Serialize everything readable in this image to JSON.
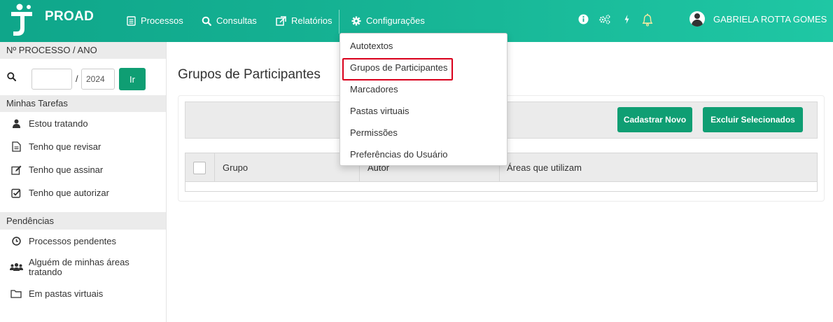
{
  "app": {
    "name": "PROAD"
  },
  "nav": {
    "processos": "Processos",
    "consultas": "Consultas",
    "relatorios": "Relatórios",
    "configuracoes": "Configurações"
  },
  "user": {
    "name": "GABRIELA ROTTA GOMES"
  },
  "icons": {
    "info": "info-icon",
    "cogs": "cogs-icon",
    "bolt": "bolt-icon",
    "bell": "bell-icon",
    "search": "search-icon",
    "user": "user-icon",
    "file": "file-icon",
    "edit": "edit-icon",
    "check": "check-square-icon",
    "clock": "clock-icon",
    "users": "users-icon",
    "folder": "folder-icon"
  },
  "colors": {
    "accent": "#0f9e73",
    "navbar": "#16b394",
    "highlight": "#d9001b"
  },
  "sidebar": {
    "process_header": "Nº PROCESSO / ANO",
    "number_value": "",
    "year_value": "2024",
    "go_label": "Ir",
    "tasks_header": "Minhas Tarefas",
    "tasks": [
      {
        "label": "Estou tratando"
      },
      {
        "label": "Tenho que revisar"
      },
      {
        "label": "Tenho que assinar"
      },
      {
        "label": "Tenho que autorizar"
      }
    ],
    "pending_header": "Pendências",
    "pending": [
      {
        "label": "Processos pendentes"
      },
      {
        "label_line1": "Alguém de minhas áreas",
        "label_line2": "tratando"
      },
      {
        "label": "Em pastas virtuais"
      }
    ]
  },
  "main": {
    "title": "Grupos de Participantes",
    "new_button": "Cadastrar Novo",
    "delete_button": "Excluir Selecionados",
    "columns": [
      "Grupo",
      "Autor",
      "Áreas que utilizam"
    ]
  },
  "dropdown": {
    "items": [
      {
        "label": "Autotextos"
      },
      {
        "label": "Grupos de Participantes",
        "highlighted": true
      },
      {
        "label": "Marcadores"
      },
      {
        "label": "Pastas virtuais"
      },
      {
        "label": "Permissões"
      },
      {
        "label": "Preferências do Usuário"
      }
    ]
  }
}
